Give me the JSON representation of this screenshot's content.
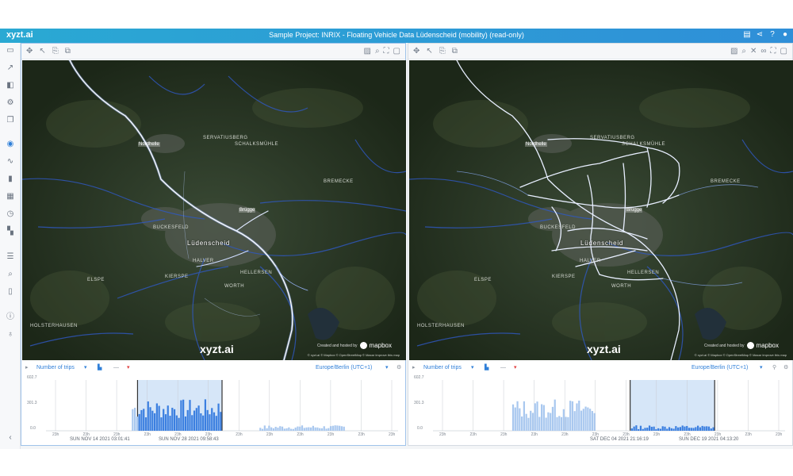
{
  "app": {
    "brand": "xyzt.ai",
    "title": "Sample Project: INRIX - Floating Vehicle Data Lüdenscheid (mobility) (read-only)",
    "title_icons": [
      "document-icon",
      "share-icon",
      "help-icon",
      "user-icon"
    ]
  },
  "rail": {
    "items": [
      "folder-icon",
      "chart-line-icon",
      "layers-icon",
      "settings-icon",
      "copy-icon",
      "globe-icon",
      "trend-icon",
      "bar-chart-icon",
      "table-icon",
      "clock-icon",
      "grid-icon",
      "list-icon",
      "search-icon",
      "map-icon",
      "info-icon",
      "bulb-icon",
      "collapse-icon"
    ]
  },
  "panels": [
    {
      "watermark": "xyzt.ai",
      "mapbox": {
        "pre": "Created and hosted by",
        "name": "mapbox"
      },
      "attribution": "© xyzt.ai © Mapbox © OpenStreetMap © Maxar Improve this map",
      "labels": {
        "city": "Lüdenscheid",
        "north": "Nordhelle",
        "east": "Brügge",
        "places": [
          "ELSPE",
          "HALVER",
          "KIERSPE",
          "BREMECKE",
          "BUCKESFELD",
          "HELLERSEN",
          "WORTH",
          "SCHALKSMÜHLE",
          "SERVATIUSBERG",
          "HOLSTERHAUSEN"
        ]
      },
      "timeline": {
        "metric": "Number of trips",
        "timezone": "Europe/Berlin (UTC+1)",
        "y_ticks": [
          "602.7",
          "301.3",
          "0.0"
        ],
        "x_ticks": [
          "23h",
          "23h",
          "23h",
          "23h",
          "23h",
          "23h",
          "23h",
          "23h",
          "23h",
          "23h",
          "23h",
          "23h"
        ],
        "selection_start": "SUN NOV 14 2021 03:01:41",
        "selection_end": "SUN NOV 28 2021 09:58:43",
        "selection": [
          0.26,
          0.5
        ]
      }
    },
    {
      "watermark": "xyzt.ai",
      "mapbox": {
        "pre": "Created and hosted by",
        "name": "mapbox"
      },
      "attribution": "© xyzt.ai © Mapbox © OpenStreetMap © Maxar Improve this map",
      "labels": {
        "city": "Lüdenscheid",
        "north": "Nordhelle",
        "east": "Brügge",
        "places": [
          "ELSPE",
          "HALVER",
          "KIERSPE",
          "BREMECKE",
          "BUCKESFELD",
          "HELLERSEN",
          "WORTH",
          "SCHALKSMÜHLE",
          "SERVATIUSBERG",
          "HOLSTERHAUSEN"
        ]
      },
      "timeline": {
        "metric": "Number of trips",
        "timezone": "Europe/Berlin (UTC+1)",
        "y_ticks": [
          "602.7",
          "301.3",
          "0.0"
        ],
        "x_ticks": [
          "23h",
          "23h",
          "23h",
          "23h",
          "23h",
          "23h",
          "23h",
          "23h",
          "23h",
          "23h",
          "23h",
          "23h"
        ],
        "selection_start": "SAT DEC 04 2021 21:16:19",
        "selection_end": "SUN DEC 19 2021 04:13:20",
        "selection": [
          0.56,
          0.8
        ]
      }
    }
  ],
  "colors": {
    "accent": "#2f7fd8",
    "selection": "#d6e6f8",
    "road": "#3b6fe0"
  }
}
